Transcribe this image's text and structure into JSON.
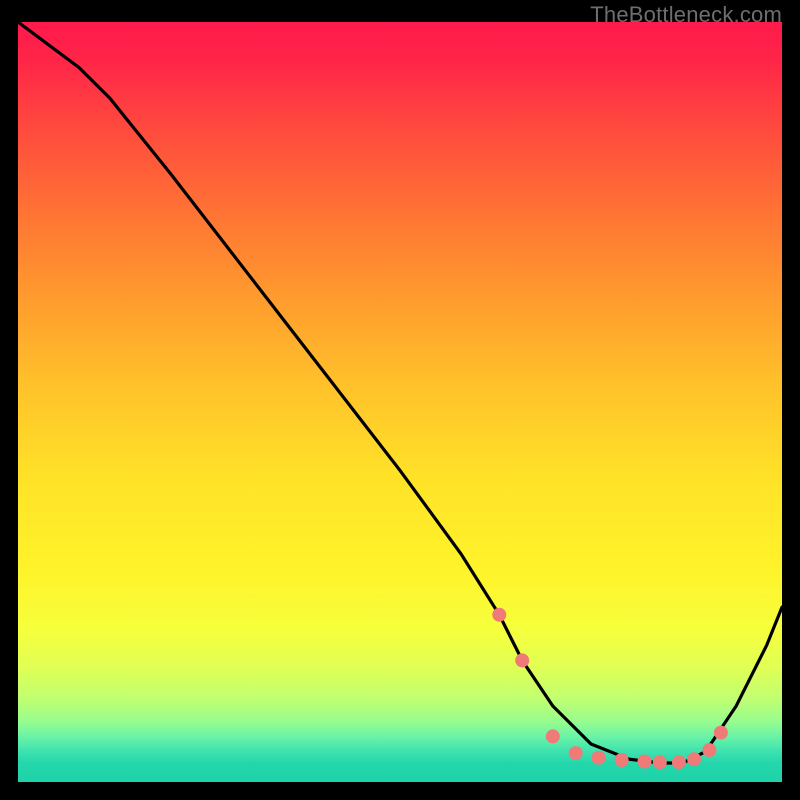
{
  "attribution": "TheBottleneck.com",
  "chart_data": {
    "type": "line",
    "title": "",
    "xlabel": "",
    "ylabel": "",
    "xlim": [
      0,
      100
    ],
    "ylim": [
      0,
      100
    ],
    "grid": false,
    "legend": false,
    "series": [
      {
        "name": "curve",
        "x": [
          0,
          8,
          12,
          20,
          30,
          40,
          50,
          58,
          63,
          66,
          70,
          75,
          80,
          84,
          87,
          90,
          94,
          98,
          100
        ],
        "values": [
          100,
          94,
          90,
          80,
          67,
          54,
          41,
          30,
          22,
          16,
          10,
          5,
          3,
          2.5,
          2.5,
          4,
          10,
          18,
          23
        ]
      }
    ],
    "markers": {
      "name": "dots",
      "color": "#f07a78",
      "radius_px": 7,
      "x": [
        63,
        66,
        70,
        73,
        76,
        79,
        82,
        84,
        86.5,
        88.5,
        90.5,
        92
      ],
      "values": [
        22,
        16,
        6,
        3.8,
        3.2,
        2.9,
        2.7,
        2.6,
        2.6,
        3.0,
        4.2,
        6.5
      ]
    },
    "background_gradient": {
      "stops": [
        {
          "pct": 0,
          "color": "#ff1a4b"
        },
        {
          "pct": 24,
          "color": "#ff6f35"
        },
        {
          "pct": 60,
          "color": "#ffe228"
        },
        {
          "pct": 85,
          "color": "#e0ff55"
        },
        {
          "pct": 97.5,
          "color": "#24d6ab"
        },
        {
          "pct": 100,
          "color": "#1ed2a9"
        }
      ]
    }
  }
}
